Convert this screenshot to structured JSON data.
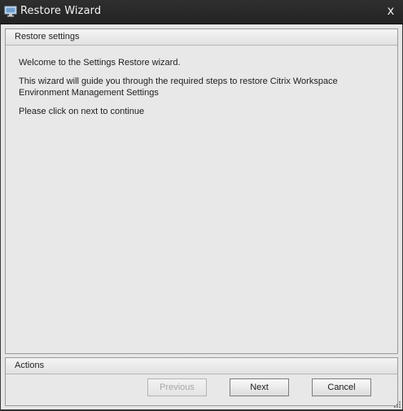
{
  "window": {
    "title": "Restore Wizard",
    "close_glyph": "x"
  },
  "settings_group": {
    "header": "Restore settings",
    "lines": [
      "Welcome to the Settings Restore wizard.",
      "This wizard will guide you through the required steps to restore Citrix Workspace Environment Management Settings",
      "Please click on next to continue"
    ]
  },
  "actions_group": {
    "header": "Actions",
    "previous_label": "Previous",
    "next_label": "Next",
    "cancel_label": "Cancel",
    "previous_enabled": false
  },
  "icons": {
    "app": "monitor-icon",
    "close": "close-icon",
    "resize": "resize-grip-icon"
  },
  "colors": {
    "titlebar": "#262626",
    "client_bg": "#e6e6e6",
    "border": "#9a9a9a"
  }
}
